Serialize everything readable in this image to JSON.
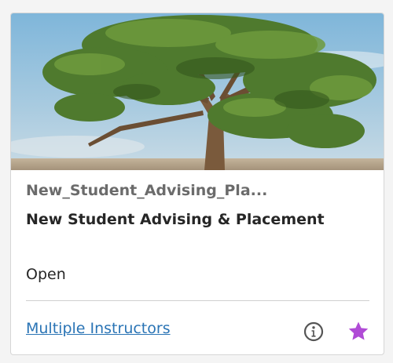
{
  "course": {
    "id_label": "New_Student_Advising_Pla...",
    "name": "New Student Advising & Placement",
    "status": "Open",
    "instructors_link": "Multiple Instructors"
  },
  "icons": {
    "hero_image": "tree-photo",
    "info": "info-icon",
    "favorite": "star-icon"
  },
  "colors": {
    "link": "#2a74b5",
    "favorite_star": "#b04bd6",
    "info_icon": "#555555"
  }
}
